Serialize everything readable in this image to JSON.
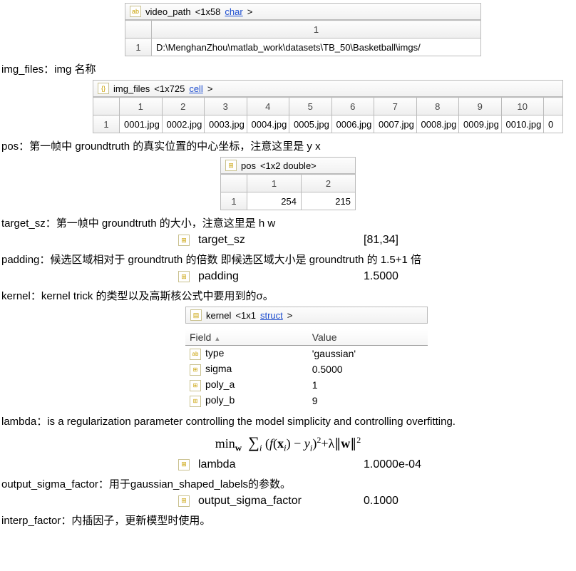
{
  "video_path": {
    "var_name": "video_path",
    "dims": "<1x58 ",
    "type_text": "char",
    "tail": ">",
    "col_header": "1",
    "row_head": "1",
    "value": "D:\\MenghanZhou\\matlab_work\\datasets\\TB_50\\Basketball\\imgs/"
  },
  "img_files_desc": "img_files：img 名称",
  "img_files": {
    "var_name": "img_files",
    "dims": "<1x725 ",
    "type_text": "cell",
    "tail": ">",
    "headers": [
      "1",
      "2",
      "3",
      "4",
      "5",
      "6",
      "7",
      "8",
      "9",
      "10"
    ],
    "row_head": "1",
    "values": [
      "0001.jpg",
      "0002.jpg",
      "0003.jpg",
      "0004.jpg",
      "0005.jpg",
      "0006.jpg",
      "0007.jpg",
      "0008.jpg",
      "0009.jpg",
      "0010.jpg"
    ],
    "trailing": "0"
  },
  "pos_desc": "pos：第一帧中 groundtruth 的真实位置的中心坐标，注意这里是  y    x",
  "pos": {
    "var_name": "pos",
    "dims": "<1x2 double>",
    "headers": [
      "1",
      "2"
    ],
    "row_head": "1",
    "values": [
      "254",
      "215"
    ]
  },
  "target_sz_desc": "target_sz：第一帧中 groundtruth 的大小，注意这里是   h    w",
  "target_sz": {
    "name": "target_sz",
    "value": "[81,34]"
  },
  "padding_desc": "padding：候选区域相对于 groundtruth 的倍数    即候选区域大小是 groundtruth 的 1.5+1 倍",
  "padding": {
    "name": "padding",
    "value": "1.5000"
  },
  "kernel_desc": "kernel：kernel trick 的类型以及高斯核公式中要用到的σ。",
  "kernel": {
    "var_name": "kernel",
    "dims": "<1x1 ",
    "type_text": "struct",
    "tail": ">",
    "field_label": "Field",
    "value_label": "Value",
    "rows": [
      {
        "field": "type",
        "value": "'gaussian'",
        "icon": "abc"
      },
      {
        "field": "sigma",
        "value": "0.5000",
        "icon": "num"
      },
      {
        "field": "poly_a",
        "value": "1",
        "icon": "num"
      },
      {
        "field": "poly_b",
        "value": "9",
        "icon": "num"
      }
    ]
  },
  "lambda_desc": "lambda：is a regularization parameter controlling the model simplicity and controlling overfitting.",
  "lambda": {
    "name": "lambda",
    "value": "1.0000e-04"
  },
  "osf_desc": "output_sigma_factor：用于gaussian_shaped_labels的参数。",
  "output_sigma_factor": {
    "name": "output_sigma_factor",
    "value": "0.1000"
  },
  "interp_desc": "interp_factor：内插因子，更新模型时使用。",
  "chart_data": null
}
